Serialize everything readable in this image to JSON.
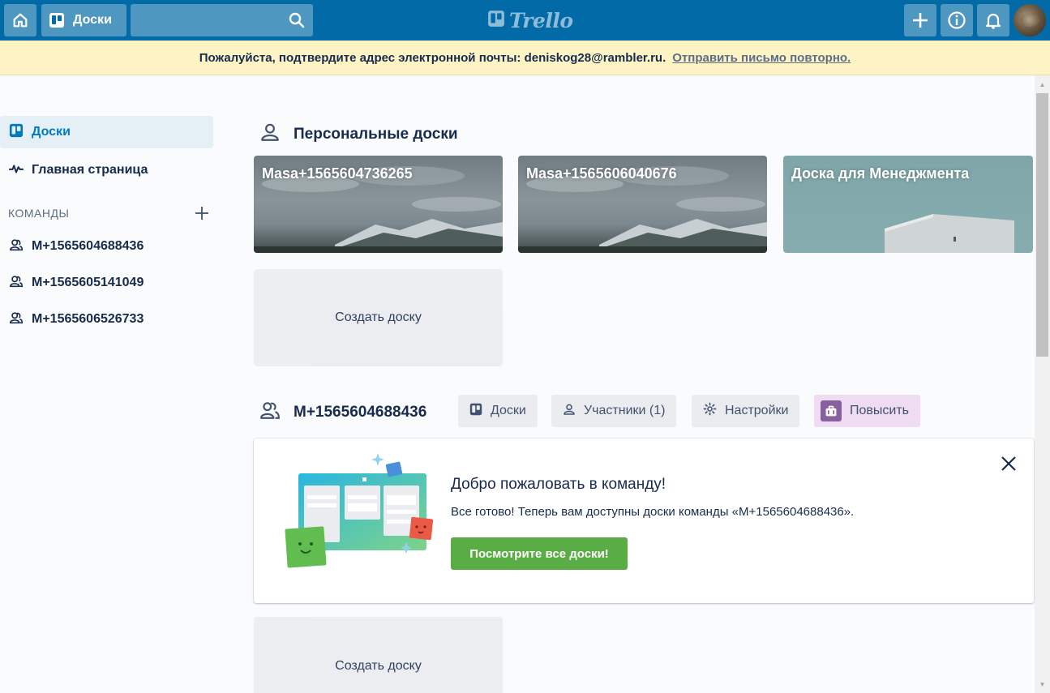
{
  "header": {
    "boards_label": "Доски",
    "search_placeholder": "",
    "logo_text": "Trello"
  },
  "banner": {
    "message": "Пожалуйста, подтвердите адрес электронной почты: deniskog28@rambler.ru.",
    "link": "Отправить письмо повторно."
  },
  "sidebar": {
    "items": [
      {
        "label": "Доски",
        "icon": "board-icon",
        "active": true
      },
      {
        "label": "Главная страница",
        "icon": "activity-icon",
        "active": false
      }
    ],
    "teams_title": "КОМАНДЫ",
    "teams": [
      {
        "label": "M+1565604688436",
        "icon": "team-icon"
      },
      {
        "label": "M+1565605141049",
        "icon": "team-icon"
      },
      {
        "label": "M+1565606526733",
        "icon": "team-icon"
      }
    ]
  },
  "personal": {
    "title": "Персональные доски",
    "boards": [
      {
        "title": "Masa+1565604736265"
      },
      {
        "title": "Masa+1565606040676"
      },
      {
        "title": "Доска для Менеджмента"
      }
    ],
    "create_label": "Создать доску"
  },
  "team_section": {
    "title": "M+1565604688436",
    "tabs": {
      "boards": "Доски",
      "members": "Участники (1)",
      "settings": "Настройки",
      "upgrade": "Повысить"
    },
    "welcome": {
      "title": "Добро пожаловать в команду!",
      "text": "Все готово! Теперь вам доступны доски команды «M+1565604688436».",
      "button": "Посмотрите все доски!"
    },
    "create_label": "Создать доску"
  },
  "colors": {
    "header_bg": "#026aa7",
    "banner_bg": "#fdf3c4",
    "accent": "#0079bf",
    "success": "#5aac44",
    "upgrade_bg": "#efdbf2"
  }
}
